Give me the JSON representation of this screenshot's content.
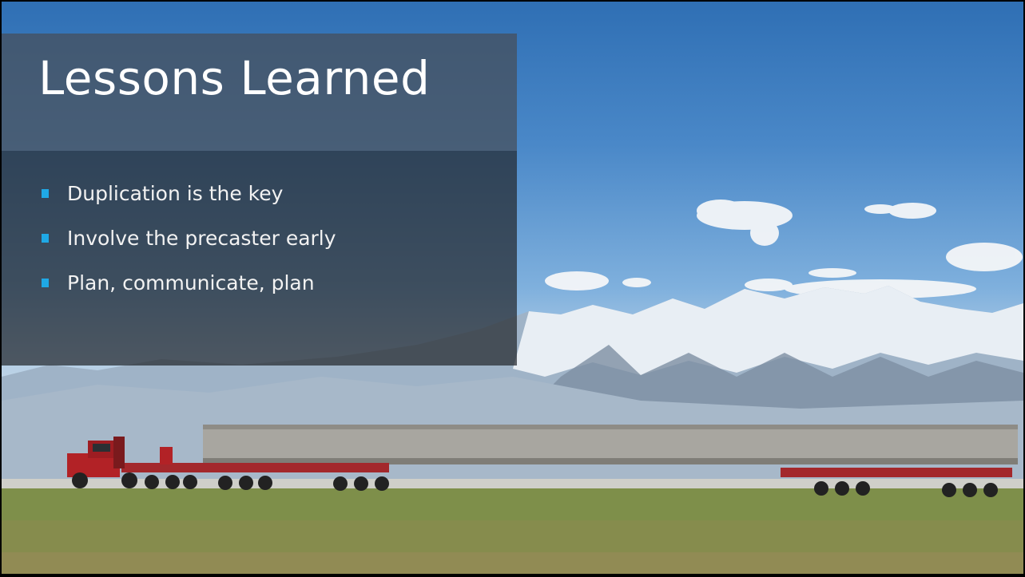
{
  "slide": {
    "title": "Lessons Learned",
    "bullets": [
      {
        "label": "Duplication is the key"
      },
      {
        "label": "Involve the precaster early"
      },
      {
        "label": "Plan, communicate, plan"
      }
    ]
  },
  "colors": {
    "bullet_marker": "#1fa9e6",
    "title_panel": "#464e58",
    "body_panel": "#24282e",
    "title_text": "#ffffff",
    "body_text": "#f2f2f2"
  },
  "background": {
    "image": "photo-truck-hauling-bridge-girder-mountains"
  }
}
